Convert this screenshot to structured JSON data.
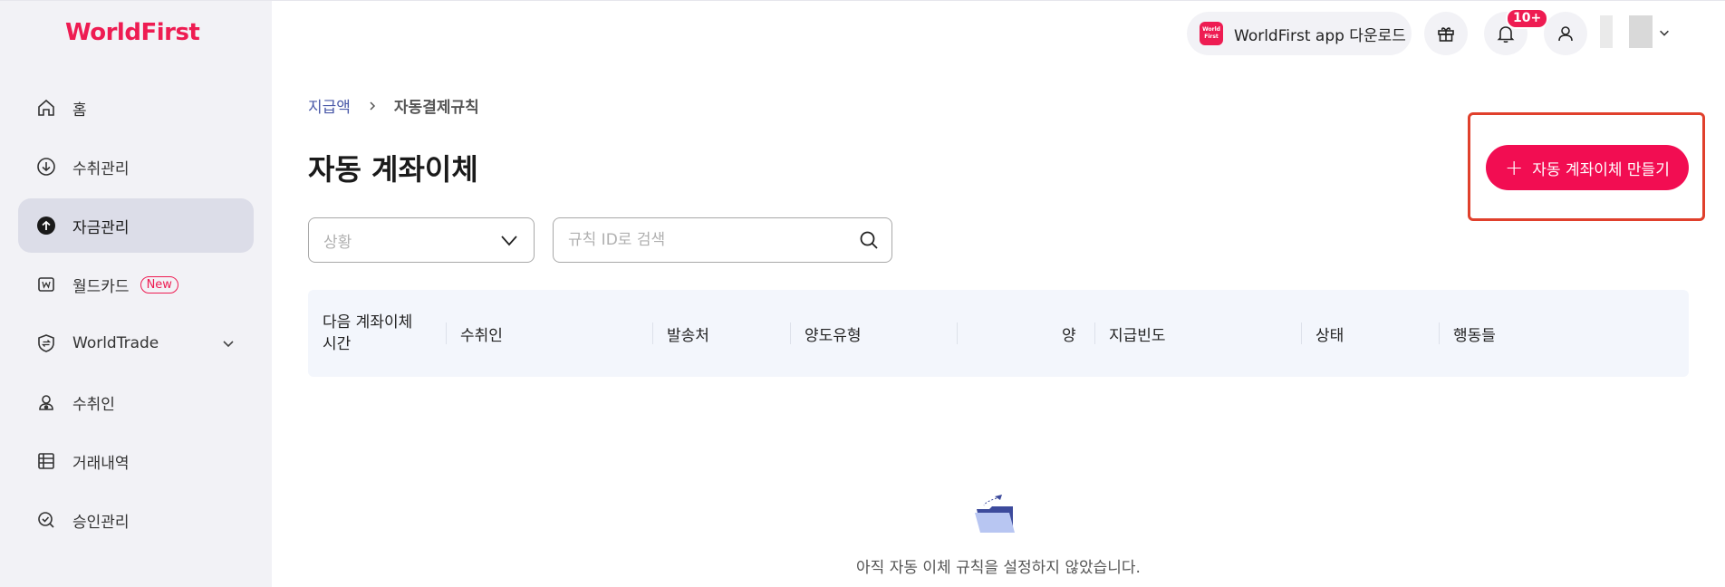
{
  "brand": {
    "logo_text": "WorldFirst",
    "accent": "#ee1c52"
  },
  "sidebar": {
    "items": [
      {
        "label": "홈",
        "icon": "home-icon"
      },
      {
        "label": "수취관리",
        "icon": "download-circle-icon"
      },
      {
        "label": "자금관리",
        "icon": "upload-circle-icon",
        "active": true
      },
      {
        "label": "월드카드",
        "icon": "card-w-icon",
        "badge": "New"
      },
      {
        "label": "WorldTrade",
        "icon": "shield-exchange-icon",
        "expandable": true
      },
      {
        "label": "수취인",
        "icon": "payee-icon"
      },
      {
        "label": "거래내역",
        "icon": "ledger-icon"
      },
      {
        "label": "승인관리",
        "icon": "approval-icon"
      }
    ]
  },
  "header": {
    "app_download_label": "WorldFirst app 다운로드",
    "app_logo_lines": [
      "World",
      "First"
    ],
    "notification_count": "10+"
  },
  "breadcrumb": {
    "parent": "지급액",
    "current": "자동결제규칙"
  },
  "page": {
    "title": "자동 계좌이체",
    "create_button_label": "자동 계좌이체 만들기",
    "create_button_plus": "+"
  },
  "filters": {
    "status_placeholder": "상황",
    "search_placeholder": "규칙 ID로 검색"
  },
  "table": {
    "columns": [
      "다음 계좌이체 시간",
      "수취인",
      "발송처",
      "양도유형",
      "양",
      "지급빈도",
      "상태",
      "행동들"
    ]
  },
  "empty_state": {
    "message": "아직 자동 이체 규칙을 설정하지 않았습니다."
  }
}
